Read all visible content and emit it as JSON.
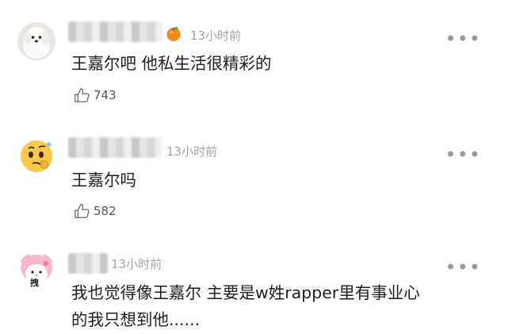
{
  "comments": [
    {
      "time": "13小时前",
      "text": "王嘉尔吧 他私生活很精彩的",
      "likes": "743",
      "avatar": "white-dog-avatar",
      "badge": "orange-fruit-icon"
    },
    {
      "time": "13小时前",
      "text": "王嘉尔吗",
      "likes": "582",
      "avatar": "thinking-face-emoji-avatar"
    },
    {
      "time": "13小时前",
      "text_lines": [
        "我也觉得像王嘉尔 主要是w姓rapper里有事业心",
        "的我只想到他......"
      ],
      "avatar": "my-melody-avatar",
      "avatar_label": "拽"
    }
  ],
  "icons": {
    "more": "more-dots-icon",
    "like": "thumbs-up-icon"
  },
  "more_glyph": "•••"
}
